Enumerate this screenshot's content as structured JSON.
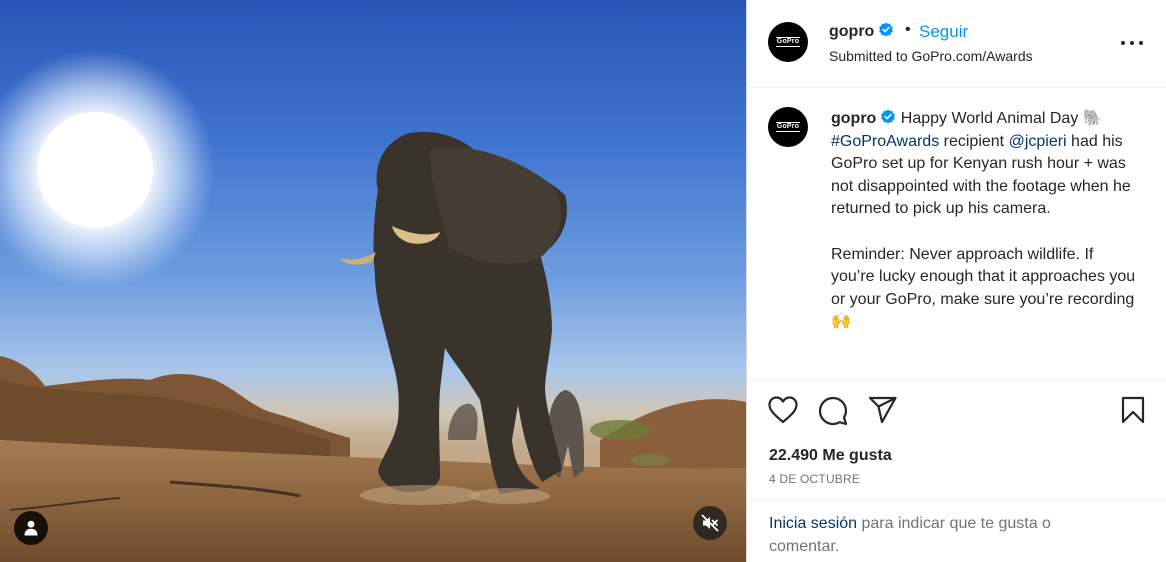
{
  "post": {
    "username": "gopro",
    "follow_label": "Seguir",
    "separator": "•",
    "location": "Submitted to GoPro.com/Awards",
    "avatar_text": "GoPro",
    "caption": {
      "username": "gopro",
      "text_1": " Happy World Animal Day 🐘\n",
      "hashtag": "#GoProAwards",
      "text_2": " recipient ",
      "mention": "@jcpieri",
      "text_3": " had his GoPro set up for Kenyan rush hour + was not disappointed with the footage when he returned to pick up his camera.\n\nReminder: Never approach wildlife. If you’re lucky enough that it approaches you or your GoPro, make sure you’re recording 🙌"
    },
    "likes": "22.490 Me gusta",
    "date": "4 DE OCTUBRE",
    "login_link": "Inicia sesión",
    "login_text": " para indicar que te gusta o comentar."
  },
  "icons": {
    "verified": "verified-badge-icon",
    "more": "more-options-icon",
    "like": "heart-icon",
    "comment": "comment-icon",
    "share": "share-icon",
    "save": "bookmark-icon",
    "tag": "user-tag-icon",
    "mute": "volume-muted-icon"
  },
  "colors": {
    "accent": "#0095f6",
    "link": "#00376b",
    "muted_text": "#737373",
    "text": "#262626"
  }
}
